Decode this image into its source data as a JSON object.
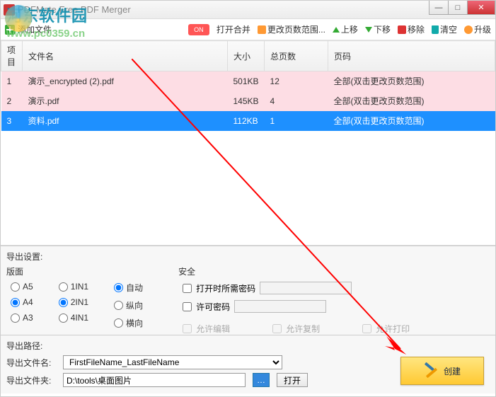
{
  "window": {
    "title": "PDFMate Free PDF Merger"
  },
  "watermark": {
    "name": "河东软件园",
    "url": "www.pc0359.cn"
  },
  "toolbar": {
    "add": "添加文件",
    "toggle": "ON",
    "merge": "打开合并",
    "range": "更改页数范围...",
    "up": "上移",
    "down": "下移",
    "remove": "移除",
    "clear": "清空",
    "upgrade": "升级"
  },
  "columns": {
    "idx": "项目",
    "name": "文件名",
    "size": "大小",
    "pages": "总页数",
    "pg": "页码"
  },
  "rows": [
    {
      "idx": "1",
      "name": "演示_encrypted (2).pdf",
      "size": "501KB",
      "pages": "12",
      "pg": "全部(双击更改页数范围)",
      "cls": "pink"
    },
    {
      "idx": "2",
      "name": "演示.pdf",
      "size": "145KB",
      "pages": "4",
      "pg": "全部(双击更改页数范围)",
      "cls": "pink"
    },
    {
      "idx": "3",
      "name": "资料.pdf",
      "size": "112KB",
      "pages": "1",
      "pg": "全部(双击更改页数范围)",
      "cls": "blue"
    }
  ],
  "settings": {
    "title": "导出设置:",
    "page": "版面",
    "sizes": {
      "a5": "A5",
      "a4": "A4",
      "a3": "A3"
    },
    "layout": {
      "n1": "1IN1",
      "n2": "2IN1",
      "n4": "4IN1"
    },
    "orient": {
      "auto": "自动",
      "port": "纵向",
      "land": "横向"
    },
    "security": "安全",
    "openpw": "打开时所需密码",
    "permpw": "许可密码",
    "edit": "允许编辑",
    "copy": "允许复制",
    "print": "允许打印"
  },
  "export": {
    "title": "导出路径:",
    "fname_lbl": "导出文件名:",
    "fname_val": "FirstFileName_LastFileName",
    "folder_lbl": "导出文件夹:",
    "folder_val": "D:\\tools\\桌面图片",
    "open": "打开"
  },
  "create": "创建"
}
